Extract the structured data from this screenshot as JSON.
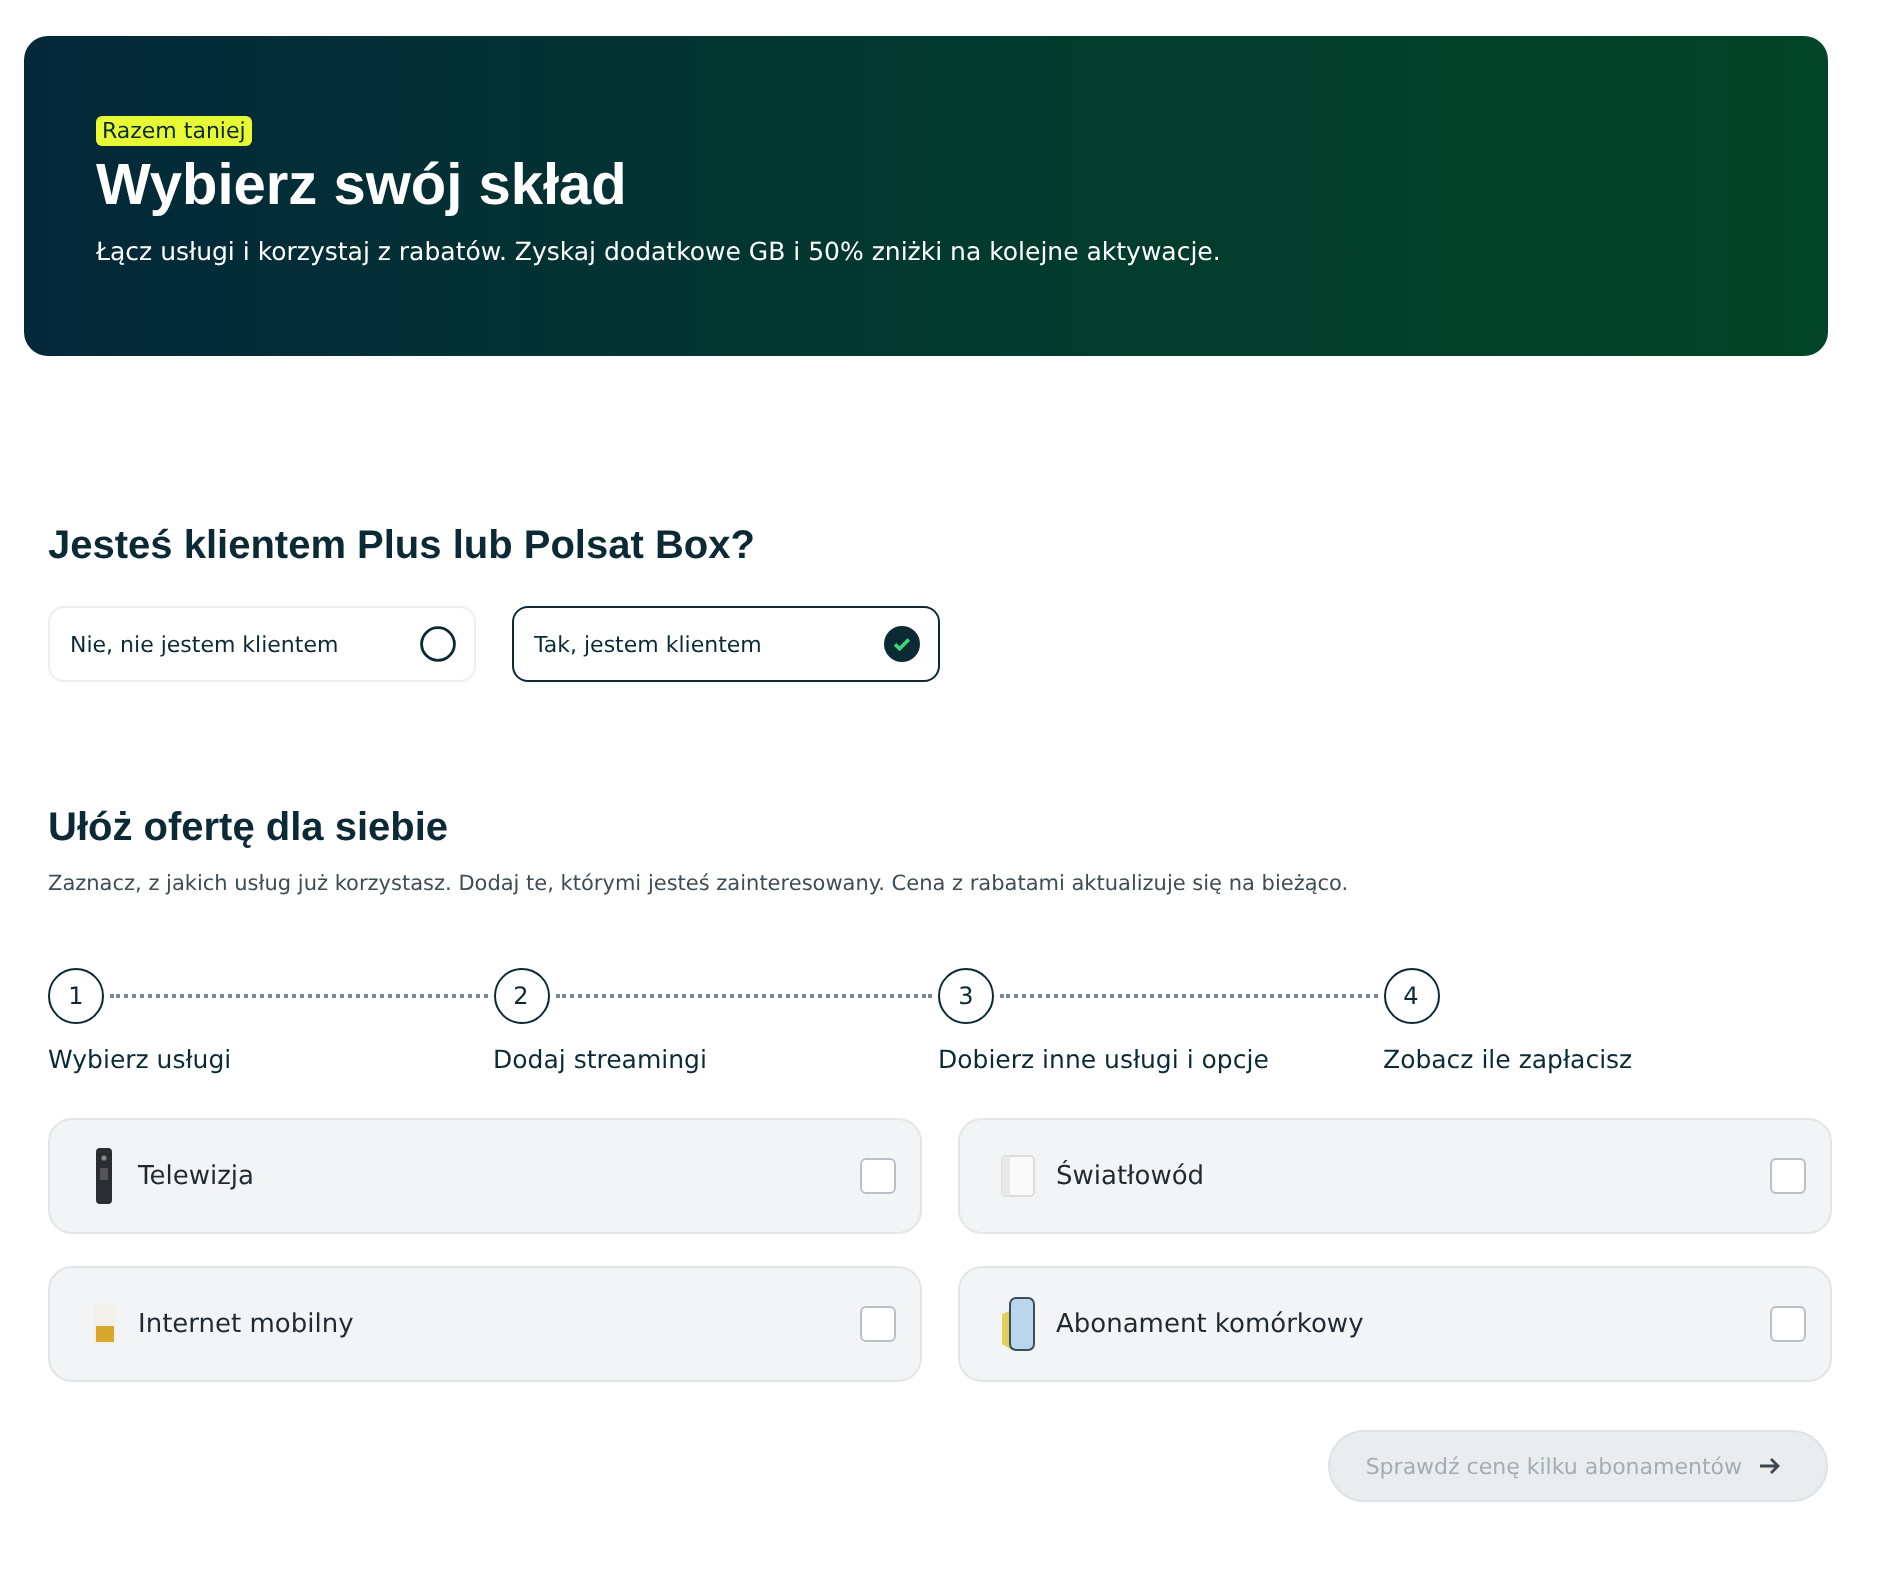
{
  "hero": {
    "badge": "Razem taniej",
    "title": "Wybierz swój skład",
    "subtitle": "Łącz usługi i korzystaj z rabatów. Zyskaj dodatkowe GB i 50% zniżki na kolejne aktywacje."
  },
  "client_question": {
    "title": "Jesteś klientem Plus lub Polsat Box?",
    "options": [
      {
        "label": "Nie, nie jestem klientem",
        "selected": false
      },
      {
        "label": "Tak, jestem klientem",
        "selected": true
      }
    ]
  },
  "offer": {
    "title": "Ułóż ofertę dla siebie",
    "description": "Zaznacz, z jakich usług już korzystasz. Dodaj te, którymi jesteś zainteresowany. Cena z rabatami aktualizuje się na bieżąco.",
    "steps": [
      {
        "number": "1",
        "label": "Wybierz usługi"
      },
      {
        "number": "2",
        "label": "Dodaj streamingi"
      },
      {
        "number": "3",
        "label": "Dobierz inne usługi i opcje"
      },
      {
        "number": "4",
        "label": "Zobacz ile zapłacisz"
      }
    ],
    "services": [
      {
        "kind": "remote",
        "label": "Telewizja",
        "checked": false
      },
      {
        "kind": "router",
        "label": "Światłowód",
        "checked": false
      },
      {
        "kind": "sim",
        "label": "Internet mobilny",
        "checked": false
      },
      {
        "kind": "phone",
        "label": "Abonament komórkowy",
        "checked": false
      }
    ],
    "button": {
      "label": "Sprawdź cenę kilku abonamentów",
      "disabled": true
    }
  }
}
